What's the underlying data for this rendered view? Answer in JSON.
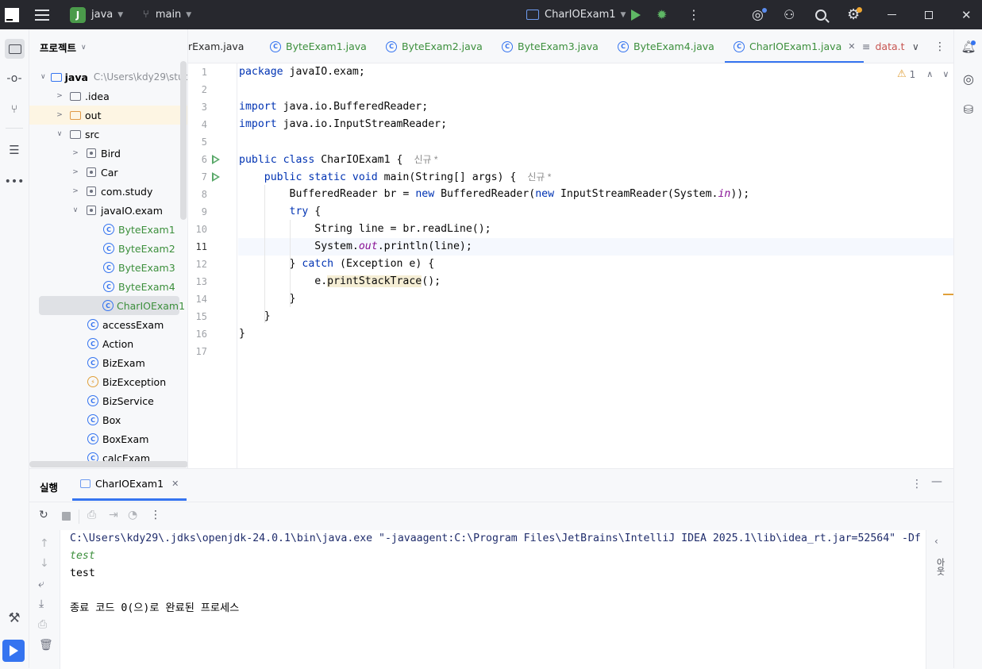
{
  "titlebar": {
    "project_badge": "J",
    "project_name": "java",
    "branch_name": "main",
    "run_config": "CharIOExam1"
  },
  "project_panel": {
    "title": "프로젝트",
    "root_name": "java",
    "root_path": "C:\\Users\\kdy29\\stud",
    "items": [
      {
        "label": ".idea"
      },
      {
        "label": "out"
      },
      {
        "label": "src"
      },
      {
        "label": "Bird"
      },
      {
        "label": "Car"
      },
      {
        "label": "com.study"
      },
      {
        "label": "javaIO.exam"
      },
      {
        "label": "ByteExam1"
      },
      {
        "label": "ByteExam2"
      },
      {
        "label": "ByteExam3"
      },
      {
        "label": "ByteExam4"
      },
      {
        "label": "CharIOExam1"
      },
      {
        "label": "accessExam"
      },
      {
        "label": "Action"
      },
      {
        "label": "BizExam"
      },
      {
        "label": "BizException"
      },
      {
        "label": "BizService"
      },
      {
        "label": "Box"
      },
      {
        "label": "BoxExam"
      },
      {
        "label": "calcExam"
      }
    ]
  },
  "tabs": [
    {
      "label": "rExam.java"
    },
    {
      "label": "ByteExam1.java"
    },
    {
      "label": "ByteExam2.java"
    },
    {
      "label": "ByteExam3.java"
    },
    {
      "label": "ByteExam4.java"
    },
    {
      "label": "CharIOExam1.java"
    },
    {
      "label": "data.t"
    }
  ],
  "editor": {
    "warning_count": "1",
    "line_numbers": [
      "1",
      "2",
      "3",
      "4",
      "5",
      "6",
      "7",
      "8",
      "9",
      "10",
      "11",
      "12",
      "13",
      "14",
      "15",
      "16",
      "17"
    ],
    "hint_new": "신규 *",
    "code": {
      "l1_kw": "package",
      "l1_rest": " javaIO.exam;",
      "l3_kw": "import",
      "l3_rest": " java.io.BufferedReader;",
      "l4_kw": "import",
      "l4_rest": " java.io.InputStreamReader;",
      "l6_kw": "public class",
      "l6_rest": " CharIOExam1 {",
      "l7_kw": "    public static void",
      "l7_rest": " main(String[] args) {",
      "l8_a": "        BufferedReader br = ",
      "l8_kw1": "new",
      "l8_b": " BufferedReader(",
      "l8_kw2": "new",
      "l8_c": " InputStreamReader(System.",
      "l8_it": "in",
      "l8_d": "));",
      "l9_kw": "        try",
      "l9_rest": " {",
      "l10": "            String line = br.readLine();",
      "l11_a": "            System.",
      "l11_it": "out",
      "l11_b": ".println(line);",
      "l12_a": "        } ",
      "l12_kw": "catch",
      "l12_b": " (Exception e) {",
      "l13_a": "            e.",
      "l13_hl": "printStackTrace",
      "l13_b": "();",
      "l14": "        }",
      "l15": "    }",
      "l16": "}"
    }
  },
  "run_panel": {
    "title": "실행",
    "tab_label": "CharIOExam1",
    "right_label": "아웃",
    "console": {
      "cmd": "C:\\Users\\kdy29\\.jdks\\openjdk-24.0.1\\bin\\java.exe \"-javaagent:C:\\Program Files\\JetBrains\\IntelliJ IDEA 2025.1\\lib\\idea_rt.jar=52564\" -Df",
      "input": "test",
      "output": "test",
      "exit": "종료 코드 0(으)로 완료된 프로세스"
    }
  },
  "colors": {
    "accent": "#3574f0",
    "titlebar_bg": "#27282e",
    "run_green": "#59a869",
    "tab_green": "#3c8f3c",
    "console_cmd": "#1f2c6b",
    "console_input": "#3c8f3c"
  }
}
